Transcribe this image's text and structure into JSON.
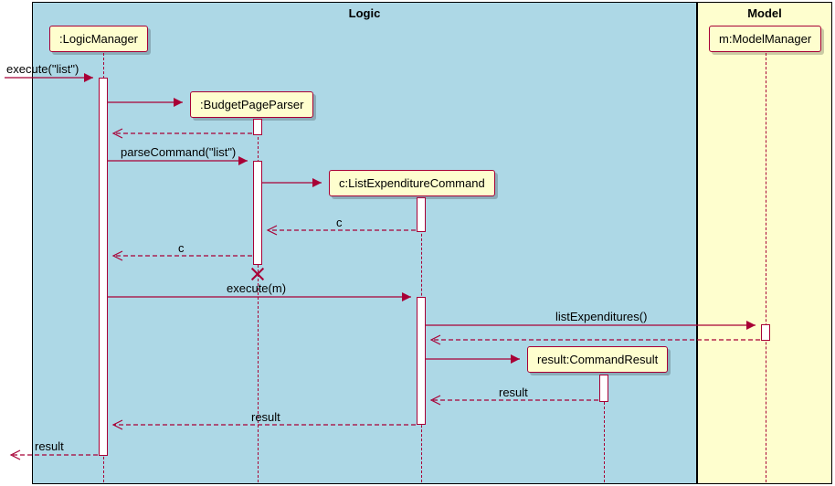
{
  "regions": {
    "logic": "Logic",
    "model": "Model"
  },
  "participants": {
    "logicManager": ":LogicManager",
    "budgetPageParser": ":BudgetPageParser",
    "listExpCommand": "c:ListExpenditureCommand",
    "commandResult": "result:CommandResult",
    "modelManager": "m:ModelManager"
  },
  "messages": {
    "executeList": "execute(\"list\")",
    "parseCommandList": "parseCommand(\"list\")",
    "returnC1": "c",
    "returnC2": "c",
    "executeM": "execute(m)",
    "listExpenditures": "listExpenditures()",
    "returnResult1": "result",
    "returnResult2": "result",
    "returnResult3": "result"
  },
  "chart_data": {
    "type": "sequence",
    "title": "",
    "regions": [
      {
        "name": "Logic",
        "participants": [
          ":LogicManager",
          ":BudgetPageParser",
          "c:ListExpenditureCommand",
          "result:CommandResult"
        ]
      },
      {
        "name": "Model",
        "participants": [
          "m:ModelManager"
        ]
      }
    ],
    "participants": [
      {
        "id": "LogicManager",
        "label": ":LogicManager",
        "created": "initial"
      },
      {
        "id": "BudgetPageParser",
        "label": ":BudgetPageParser",
        "created": "by_message"
      },
      {
        "id": "ListExpenditureCommand",
        "label": "c:ListExpenditureCommand",
        "created": "by_message"
      },
      {
        "id": "CommandResult",
        "label": "result:CommandResult",
        "created": "by_message"
      },
      {
        "id": "ModelManager",
        "label": "m:ModelManager",
        "created": "initial"
      }
    ],
    "messages": [
      {
        "from": "external",
        "to": "LogicManager",
        "label": "execute(\"list\")",
        "type": "sync"
      },
      {
        "from": "LogicManager",
        "to": "BudgetPageParser",
        "label": "",
        "type": "create"
      },
      {
        "from": "BudgetPageParser",
        "to": "LogicManager",
        "label": "",
        "type": "return"
      },
      {
        "from": "LogicManager",
        "to": "BudgetPageParser",
        "label": "parseCommand(\"list\")",
        "type": "sync"
      },
      {
        "from": "BudgetPageParser",
        "to": "ListExpenditureCommand",
        "label": "",
        "type": "create"
      },
      {
        "from": "ListExpenditureCommand",
        "to": "BudgetPageParser",
        "label": "c",
        "type": "return"
      },
      {
        "from": "BudgetPageParser",
        "to": "LogicManager",
        "label": "c",
        "type": "return"
      },
      {
        "from": "BudgetPageParser",
        "to": null,
        "label": "",
        "type": "destroy"
      },
      {
        "from": "LogicManager",
        "to": "ListExpenditureCommand",
        "label": "execute(m)",
        "type": "sync"
      },
      {
        "from": "ListExpenditureCommand",
        "to": "ModelManager",
        "label": "listExpenditures()",
        "type": "sync"
      },
      {
        "from": "ModelManager",
        "to": "ListExpenditureCommand",
        "label": "",
        "type": "return"
      },
      {
        "from": "ListExpenditureCommand",
        "to": "CommandResult",
        "label": "",
        "type": "create"
      },
      {
        "from": "CommandResult",
        "to": "ListExpenditureCommand",
        "label": "result",
        "type": "return"
      },
      {
        "from": "ListExpenditureCommand",
        "to": "LogicManager",
        "label": "result",
        "type": "return"
      },
      {
        "from": "LogicManager",
        "to": "external",
        "label": "result",
        "type": "return"
      }
    ]
  }
}
